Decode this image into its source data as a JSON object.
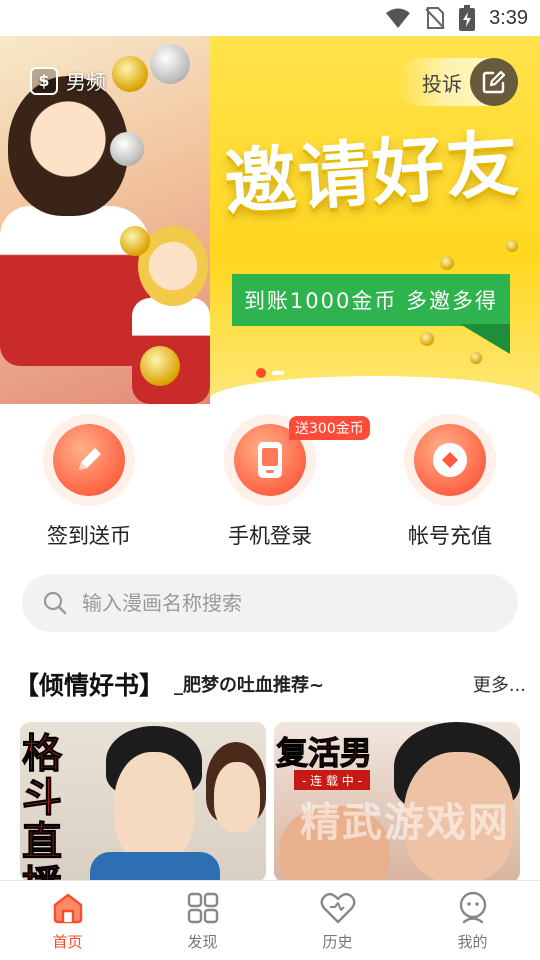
{
  "status_bar": {
    "time": "3:39"
  },
  "banner": {
    "gender_label": "男频",
    "report_label": "投诉",
    "title": "邀请好友",
    "subtitle": "到账1000金币  多邀多得",
    "active_slide": 1,
    "slide_count": 2
  },
  "features": [
    {
      "label": "签到送币",
      "icon": "pencil-icon"
    },
    {
      "label": "手机登录",
      "icon": "phone-icon",
      "badge": "送300金币"
    },
    {
      "label": "帐号充值",
      "icon": "coin-icon"
    }
  ],
  "search": {
    "placeholder": "输入漫画名称搜索",
    "value": ""
  },
  "section": {
    "title": "【倾情好书】",
    "subtitle": "_肥梦の吐血推荐~",
    "more": "更多..."
  },
  "books": [
    {
      "cover_title": "格斗直播"
    },
    {
      "cover_title": "复活男",
      "tag": "- 连 载 中 -"
    }
  ],
  "watermark": "精武游戏网",
  "tabbar": {
    "items": [
      {
        "label": "首页",
        "icon": "home-icon",
        "active": true
      },
      {
        "label": "发现",
        "icon": "grid-icon",
        "active": false
      },
      {
        "label": "历史",
        "icon": "heart-icon",
        "active": false
      },
      {
        "label": "我的",
        "icon": "profile-icon",
        "active": false
      }
    ]
  },
  "colors": {
    "accent": "#ff4b2b",
    "banner_yellow": "#ffd71f",
    "ribbon_green": "#2fb34f"
  }
}
